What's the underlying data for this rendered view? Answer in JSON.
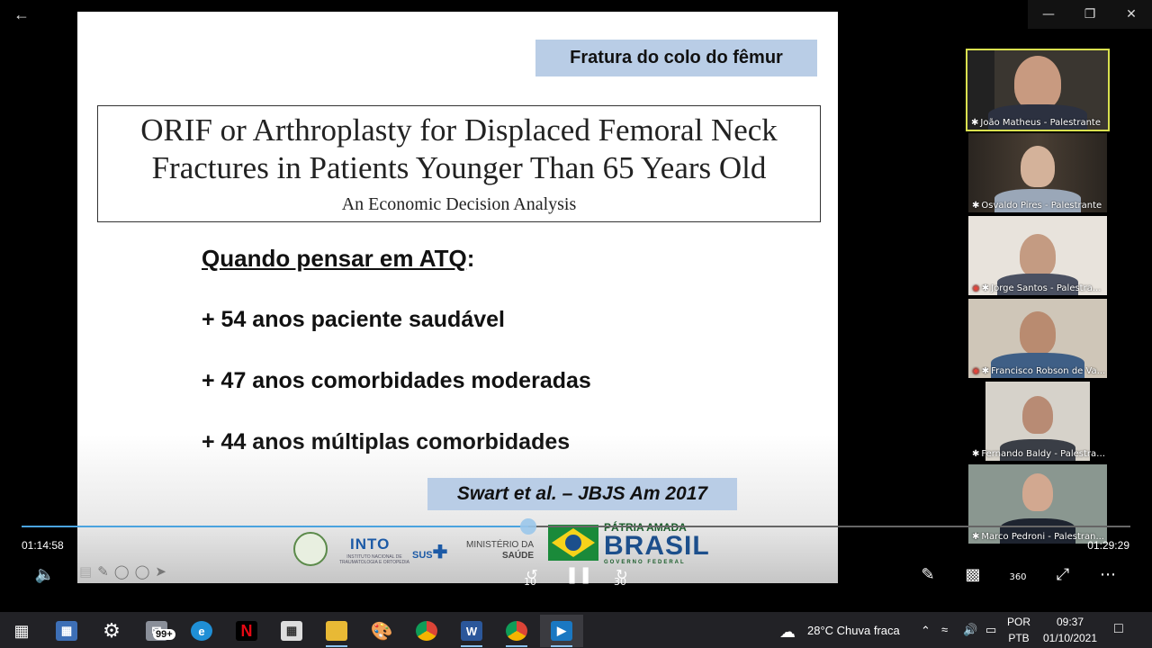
{
  "slide": {
    "tag": "Fratura do colo do fêmur",
    "paper_title_line1": "ORIF or Arthroplasty for Displaced Femoral Neck",
    "paper_title_line2": "Fractures in Patients Younger Than 65 Years Old",
    "paper_subtitle": "An Economic Decision Analysis",
    "heading": "Quando pensar em ATQ",
    "heading_colon": ":",
    "bullets": [
      "+ 54 anos paciente saudável",
      "+ 47 anos comorbidades moderadas",
      "+ 44 anos múltiplas comorbidades"
    ],
    "citation": "Swart  et al. – JBJS Am 2017",
    "logos": {
      "into": "INTO",
      "into_sub": "INSTITUTO NACIONAL DE TRAUMATOLOGIA E ORTOPEDIA",
      "sus": "SUS",
      "ministerio_line1": "MINISTÉRIO DA",
      "ministerio_line2": "SAÚDE",
      "patria": "PÁTRIA AMADA",
      "brasil": "BRASIL",
      "governo": "GOVERNO FEDERAL"
    }
  },
  "participants": [
    {
      "name": "João Matheus - Palestrante",
      "muted": false,
      "active": true
    },
    {
      "name": "Osvaldo Pires - Palestrante",
      "muted": false,
      "active": false
    },
    {
      "name": "Jorge Santos - Palestra...",
      "muted": true,
      "active": false
    },
    {
      "name": "Francisco Robson de Va...",
      "muted": true,
      "active": false
    },
    {
      "name": "Fernando Baldy - Palestrante",
      "muted": false,
      "active": false
    },
    {
      "name": "Marco Pedroni - Palestran...",
      "muted": false,
      "active": false
    }
  ],
  "player": {
    "elapsed": "01:14:58",
    "total": "01:29:29",
    "progress": 0.457,
    "skip_back": "10",
    "skip_forward": "30",
    "vr_label": "360"
  },
  "taskbar": {
    "mail_badge": "99+",
    "weather": "28°C  Chuva fraca",
    "lang_line1": "POR",
    "lang_line2": "PTB",
    "clock_time": "09:37",
    "clock_date": "01/10/2021"
  },
  "colors": {
    "accent": "#4aa3df",
    "active_speaker": "#d9e04f",
    "slide_tag_bg": "#b9cde6"
  }
}
